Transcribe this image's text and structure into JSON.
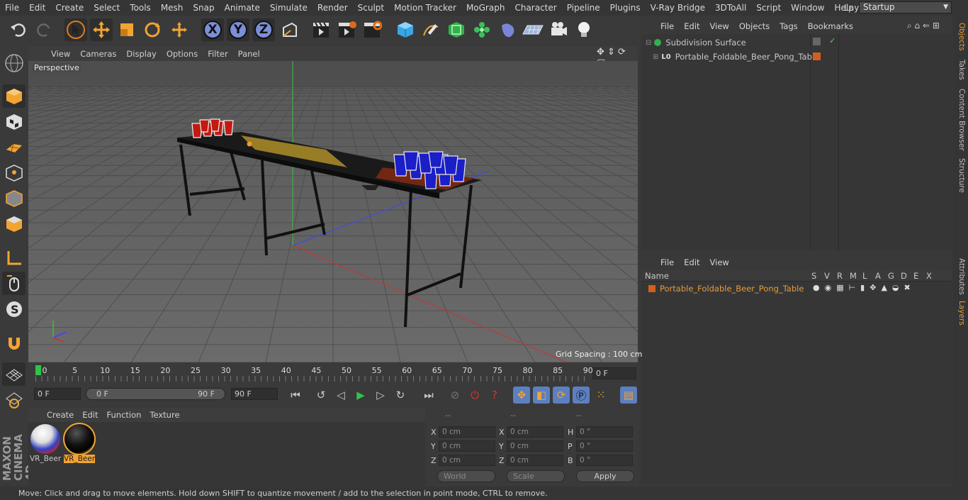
{
  "menubar": {
    "items": [
      "File",
      "Edit",
      "Create",
      "Select",
      "Tools",
      "Mesh",
      "Snap",
      "Animate",
      "Simulate",
      "Render",
      "Sculpt",
      "Motion Tracker",
      "MoGraph",
      "Character",
      "Pipeline",
      "Plugins",
      "V-Ray Bridge",
      "3DToAll",
      "Script",
      "Window",
      "Help"
    ],
    "layout_label": "Layout:",
    "layout_value": "Startup"
  },
  "toolbar": {
    "axis_x": "X",
    "axis_y": "Y",
    "axis_z": "Z"
  },
  "viewport": {
    "menu": [
      "View",
      "Cameras",
      "Display",
      "Options",
      "Filter",
      "Panel"
    ],
    "label": "Perspective",
    "grid_spacing": "Grid Spacing : 100 cm"
  },
  "timeline": {
    "ticks": [
      "0",
      "5",
      "10",
      "15",
      "20",
      "25",
      "30",
      "35",
      "40",
      "45",
      "50",
      "55",
      "60",
      "65",
      "70",
      "75",
      "80",
      "85",
      "90"
    ],
    "current_frame": "0 F"
  },
  "transport": {
    "start_field": "0 F",
    "range_start": "0 F",
    "range_end": "90 F",
    "end_field": "90 F"
  },
  "materials": {
    "menu": [
      "Create",
      "Edit",
      "Function",
      "Texture"
    ],
    "items": [
      {
        "name": "VR_Beer",
        "selected": false
      },
      {
        "name": "VR_Beer",
        "selected": true
      }
    ]
  },
  "coords": {
    "headers": [
      "--",
      "--",
      "--"
    ],
    "rows": [
      {
        "a": "X",
        "av": "0 cm",
        "b": "X",
        "bv": "0 cm",
        "c": "H",
        "cv": "0 °"
      },
      {
        "a": "Y",
        "av": "0 cm",
        "b": "Y",
        "bv": "0 cm",
        "c": "P",
        "cv": "0 °"
      },
      {
        "a": "Z",
        "av": "0 cm",
        "b": "Z",
        "bv": "0 cm",
        "c": "B",
        "cv": "0 °"
      }
    ],
    "world": "World",
    "scale": "Scale",
    "apply": "Apply"
  },
  "object_manager": {
    "menu": [
      "File",
      "Edit",
      "View",
      "Objects",
      "Tags",
      "Bookmarks"
    ],
    "objects": [
      "Subdivision Surface",
      "Portable_Foldable_Beer_Pong_Table"
    ]
  },
  "layer_manager": {
    "menu": [
      "File",
      "Edit",
      "View"
    ],
    "columns": [
      "Name",
      "S",
      "V",
      "R",
      "M",
      "L",
      "A",
      "G",
      "D",
      "E",
      "X"
    ],
    "layer": "Portable_Foldable_Beer_Pong_Table"
  },
  "side_tabs": [
    "Objects",
    "Takes",
    "Content Browser",
    "Structure"
  ],
  "side_tabs2": [
    "Attributes",
    "Layers"
  ],
  "brand": "MAXON CINEMA 4D",
  "status": "Move: Click and drag to move elements. Hold down SHIFT to quantize movement / add to the selection in point mode, CTRL to remove.",
  "colors": {
    "accent": "#e49b3b",
    "cup_red": "#c21a12",
    "cup_blue": "#1a1fc8",
    "axis_x": "#d03030",
    "axis_y": "#3fbf3f",
    "axis_z": "#3a46ff"
  }
}
